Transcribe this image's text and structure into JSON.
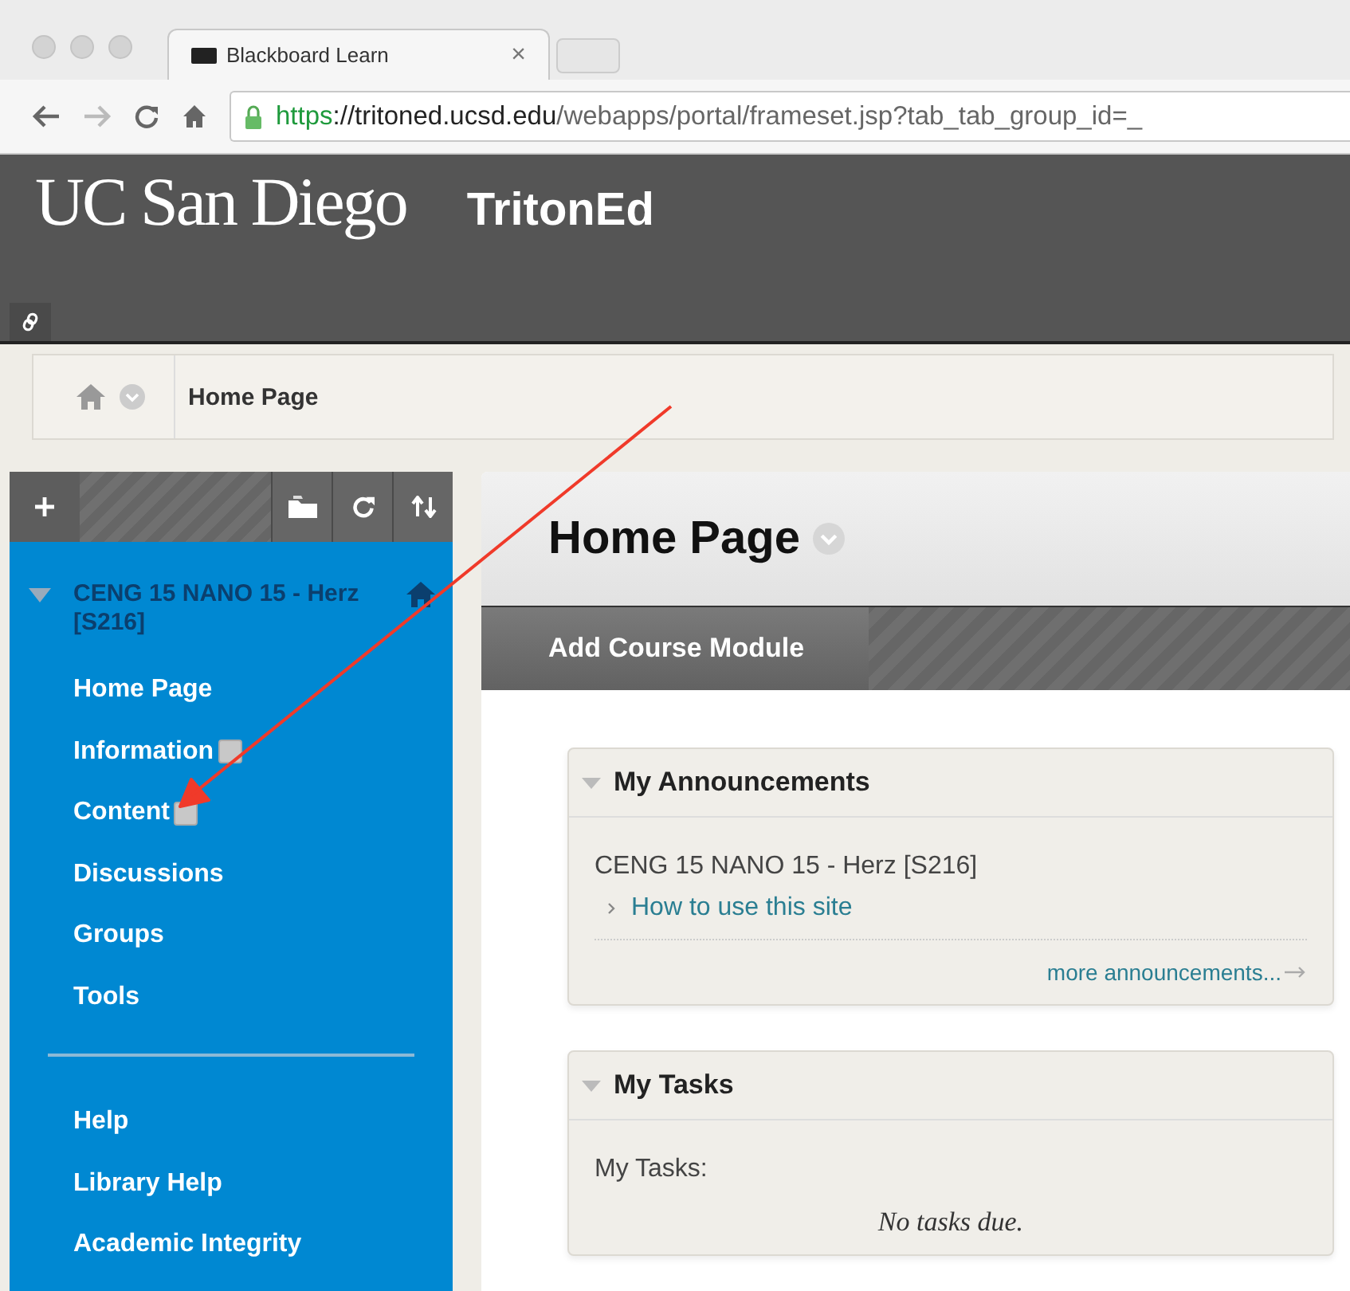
{
  "browser": {
    "tab": {
      "title": "Blackboard Learn",
      "close": "×"
    },
    "url": {
      "scheme": "https",
      "host": "://tritoned.ucsd.edu",
      "path": "/webapps/portal/frameset.jsp?tab_tab_group_id=_"
    }
  },
  "header": {
    "logo": "UC San Diego",
    "product": "TritonEd"
  },
  "breadcrumb": {
    "current": "Home Page"
  },
  "sidebar": {
    "course": {
      "title": "CENG 15 NANO 15 - Herz [S216]",
      "expanded": true
    },
    "items": [
      {
        "label": "Home Page",
        "badge": false
      },
      {
        "label": "Information",
        "badge": true
      },
      {
        "label": "Content",
        "badge": true
      },
      {
        "label": "Discussions",
        "badge": false
      },
      {
        "label": "Groups",
        "badge": false
      },
      {
        "label": "Tools",
        "badge": false
      }
    ],
    "links": [
      {
        "label": "Help"
      },
      {
        "label": "Library Help"
      },
      {
        "label": "Academic Integrity"
      }
    ]
  },
  "main": {
    "title": "Home Page",
    "action": "Add Course Module",
    "modules": [
      {
        "title": "My Announcements",
        "expanded": true,
        "kind": "announcements",
        "course": "CENG 15 NANO 15 - Herz [S216]",
        "link": "How to use this site",
        "more": "more announcements..."
      },
      {
        "title": "My Tasks",
        "expanded": true,
        "kind": "tasks",
        "label": "My Tasks:",
        "empty": "No tasks due."
      }
    ]
  }
}
